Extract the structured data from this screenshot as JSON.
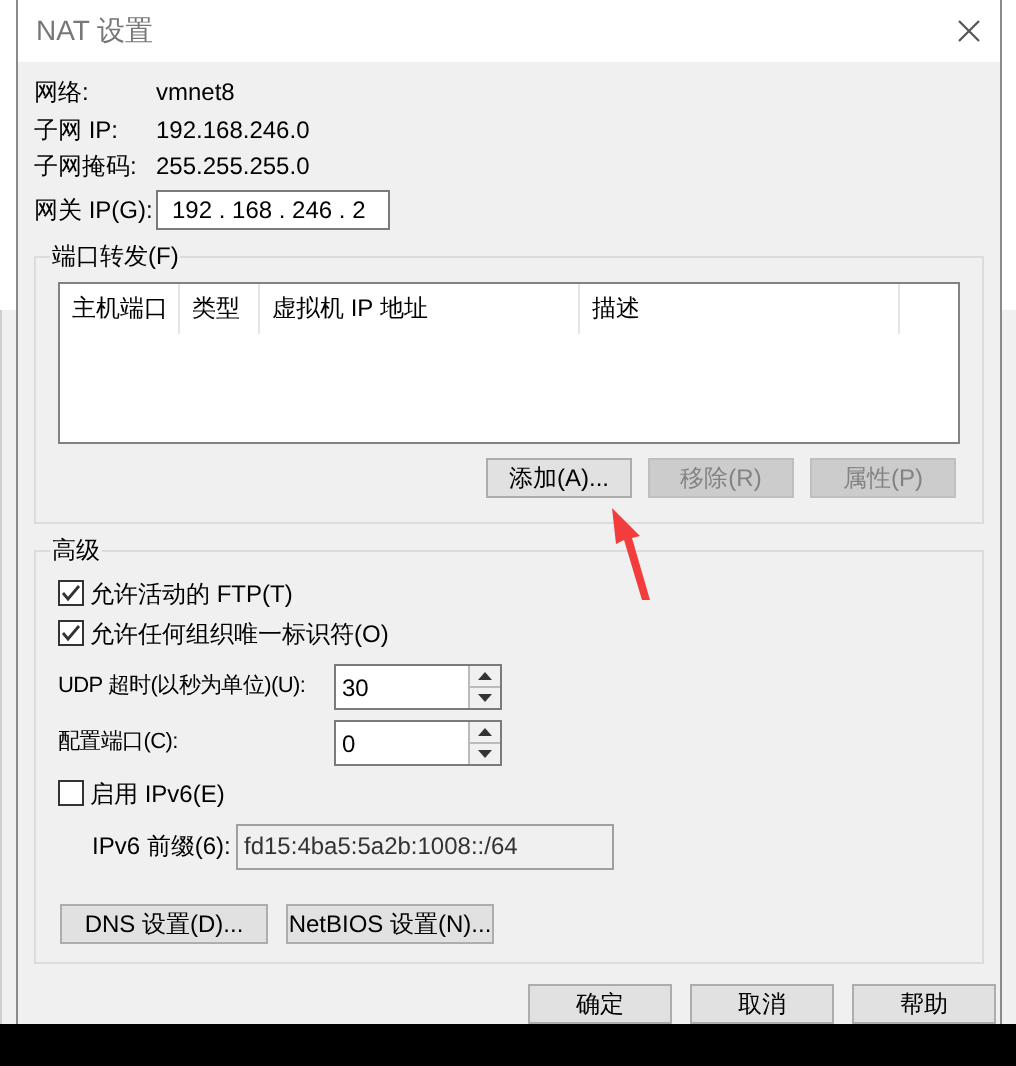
{
  "window": {
    "title": "NAT 设置"
  },
  "info": [
    {
      "label": "网络:",
      "value": "vmnet8"
    },
    {
      "label": "子网 IP:",
      "value": "192.168.246.0"
    },
    {
      "label": "子网掩码:",
      "value": "255.255.255.0"
    }
  ],
  "gateway": {
    "label": "网关 IP(G):",
    "value": "192 . 168 . 246 .  2"
  },
  "port_forwarding": {
    "title": "端口转发(F)",
    "columns": [
      "主机端口",
      "类型",
      "虚拟机 IP 地址",
      "描述"
    ],
    "buttons": [
      {
        "label": "添加(A)...",
        "disabled": false
      },
      {
        "label": "移除(R)",
        "disabled": true
      },
      {
        "label": "属性(P)",
        "disabled": true
      }
    ]
  },
  "advanced": {
    "title": "高级",
    "checkboxes": [
      {
        "label": "允许活动的 FTP(T)",
        "checked": true
      },
      {
        "label": "允许任何组织唯一标识符(O)",
        "checked": true
      }
    ],
    "spinners": [
      {
        "label": "UDP 超时(以秒为单位)(U):",
        "value": "30"
      },
      {
        "label": "配置端口(C):",
        "value": "0"
      }
    ],
    "ipv6": {
      "label": "启用 IPv6(E)",
      "checked": false
    },
    "prefix": {
      "label": "IPv6 前缀(6):",
      "value": "fd15:4ba5:5a2b:1008::/64",
      "disabled": true
    },
    "buttons": [
      "DNS 设置(D)...",
      "NetBIOS 设置(N)..."
    ]
  },
  "dialog_buttons": [
    "确定",
    "取消",
    "帮助"
  ]
}
